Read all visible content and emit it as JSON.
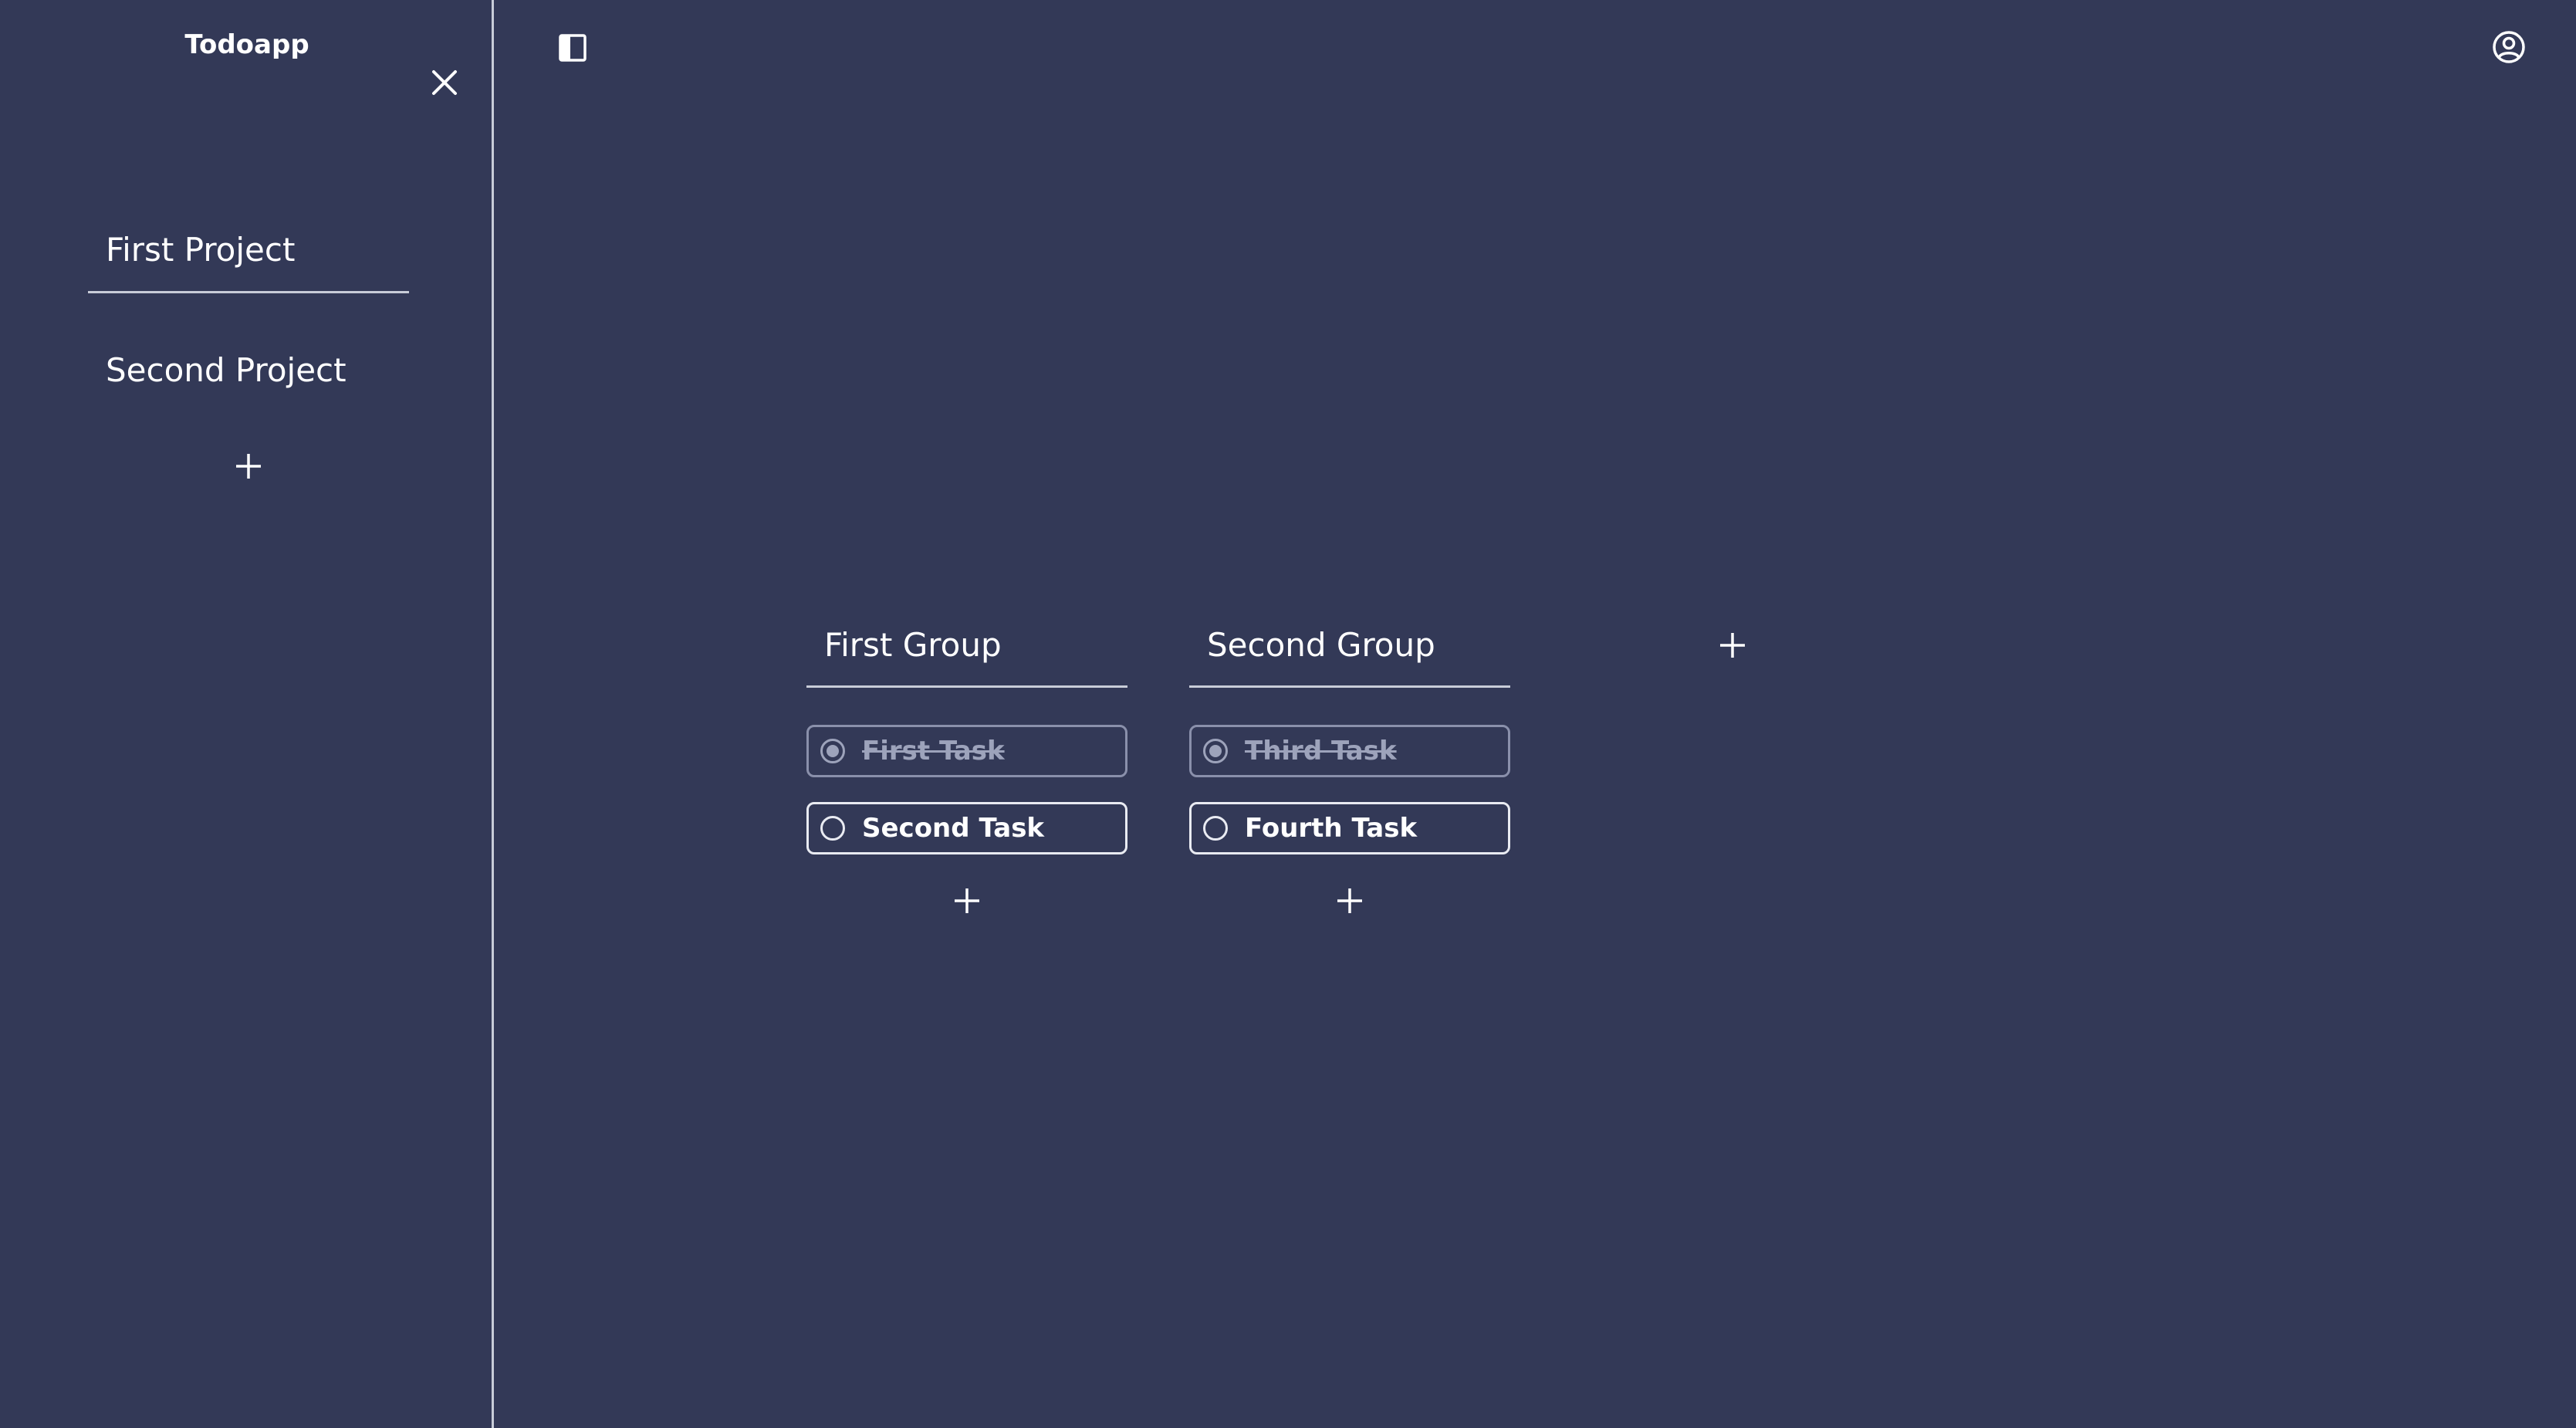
{
  "app": {
    "title": "Todoapp",
    "background_color": "#333957",
    "text_color": "#ffffff",
    "divider_color": "#c8ccd8"
  },
  "sidebar": {
    "close_icon": "close-icon",
    "projects": [
      {
        "label": "First Project",
        "selected": true
      },
      {
        "label": "Second Project",
        "selected": false
      }
    ],
    "add_icon": "plus-icon"
  },
  "topbar": {
    "toggle_icon": "sidebar-toggle-icon",
    "account_icon": "user-circle-icon"
  },
  "board": {
    "groups": [
      {
        "title": "First Group",
        "tasks": [
          {
            "label": "First Task",
            "done": true
          },
          {
            "label": "Second Task",
            "done": false
          }
        ]
      },
      {
        "title": "Second Group",
        "tasks": [
          {
            "label": "Third Task",
            "done": true
          },
          {
            "label": "Fourth Task",
            "done": false
          }
        ]
      }
    ],
    "add_group_icon": "plus-icon",
    "add_task_icon": "plus-icon"
  }
}
